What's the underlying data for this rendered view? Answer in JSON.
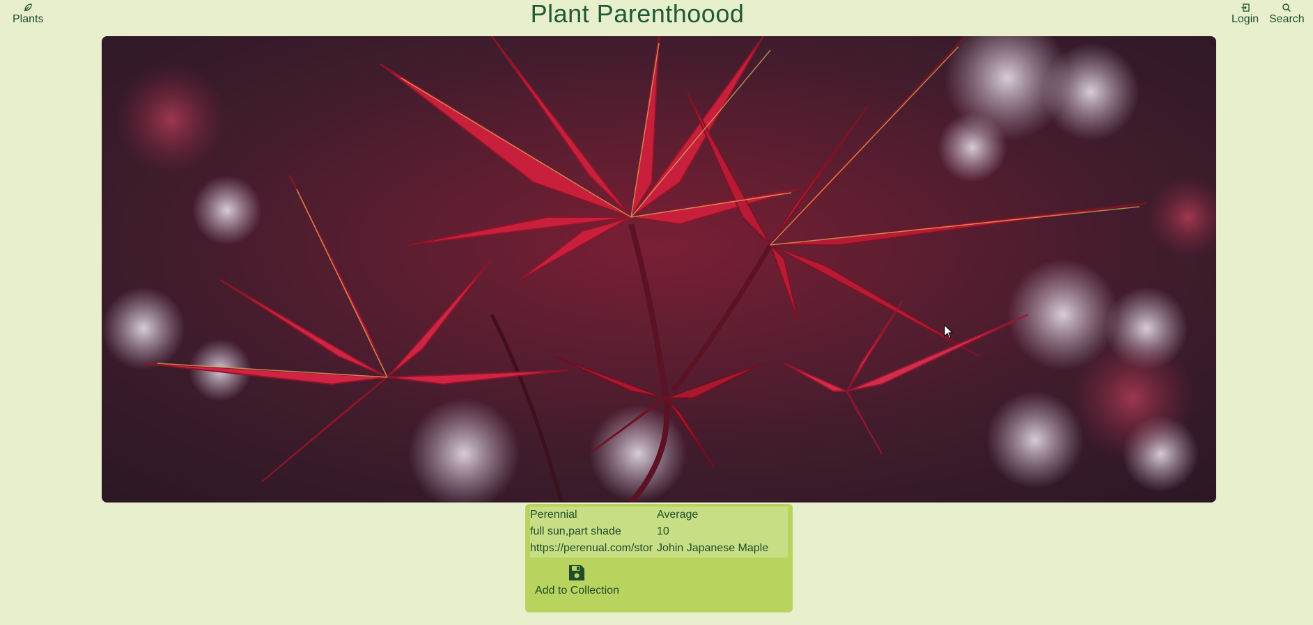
{
  "header": {
    "title": "Plant Parenthoood",
    "nav_plants": {
      "label": "Plants",
      "icon": "leaf-icon"
    },
    "nav_login": {
      "label": "Login",
      "icon": "login-icon"
    },
    "nav_search": {
      "label": "Search",
      "icon": "search-icon"
    }
  },
  "hero": {
    "icon": "red-japanese-maple-leaves-photo"
  },
  "details": {
    "rows": [
      [
        "Perennial",
        "Average"
      ],
      [
        "full sun,part shade",
        "10"
      ],
      [
        "https://perenual.com/stor",
        "Johin Japanese Maple"
      ]
    ],
    "add_button": {
      "label": "Add to Collection",
      "icon": "save-disk-icon"
    }
  },
  "colors": {
    "background": "#e7efcd",
    "card": "#b9d45e",
    "table": "#c7de84",
    "text": "#1f4d2c"
  }
}
